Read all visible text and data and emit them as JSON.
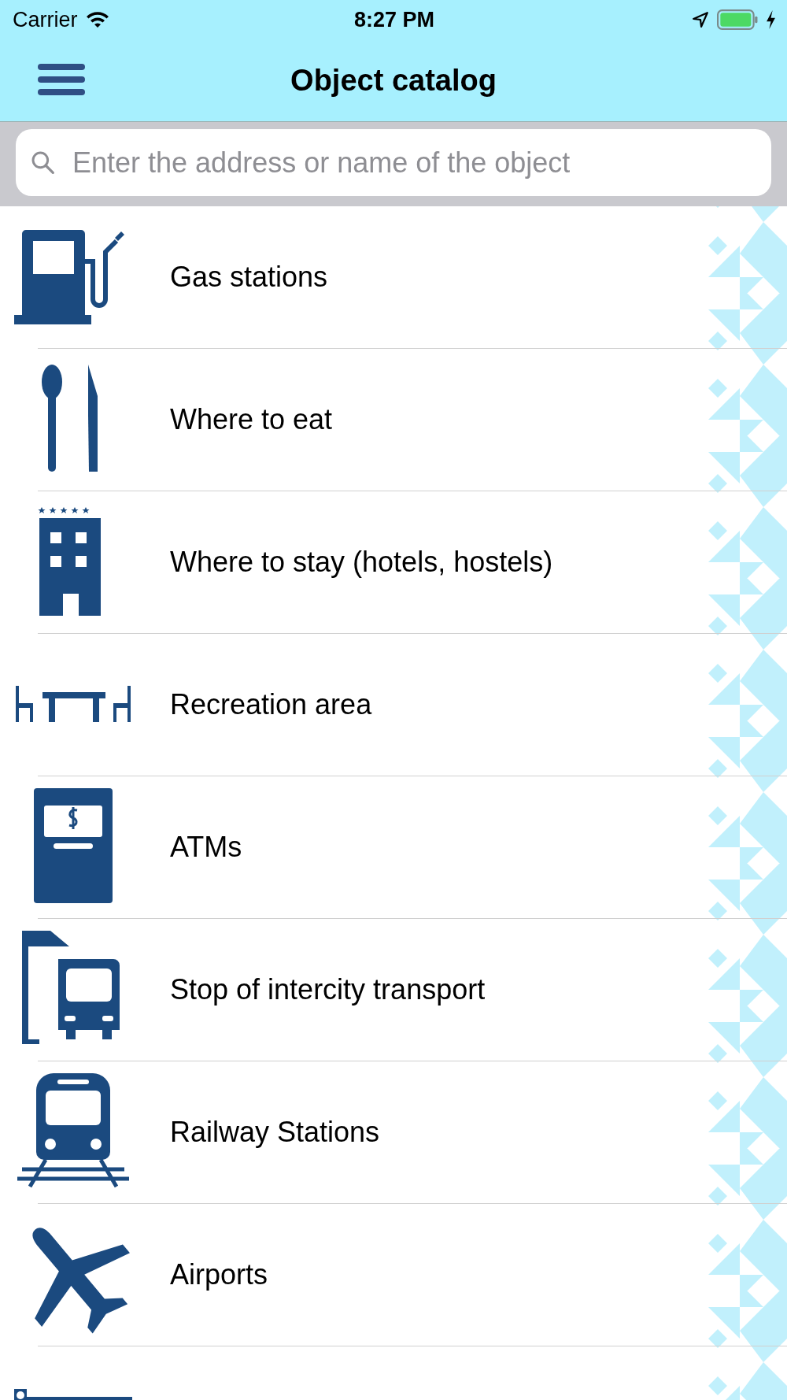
{
  "status_bar": {
    "carrier": "Carrier",
    "time": "8:27 PM",
    "battery_charging": true
  },
  "nav_bar": {
    "title": "Object catalog"
  },
  "search": {
    "placeholder": "Enter the address or name of the object"
  },
  "categories": [
    {
      "kind": "fuel",
      "label": "Gas stations"
    },
    {
      "kind": "food",
      "label": "Where to eat"
    },
    {
      "kind": "hotel",
      "label": "Where to stay (hotels, hostels)"
    },
    {
      "kind": "recreation",
      "label": "Recreation area"
    },
    {
      "kind": "atm",
      "label": "ATMs"
    },
    {
      "kind": "bus",
      "label": "Stop of intercity transport"
    },
    {
      "kind": "train",
      "label": "Railway Stations"
    },
    {
      "kind": "plane",
      "label": "Airports"
    },
    {
      "kind": "cut"
    }
  ]
}
